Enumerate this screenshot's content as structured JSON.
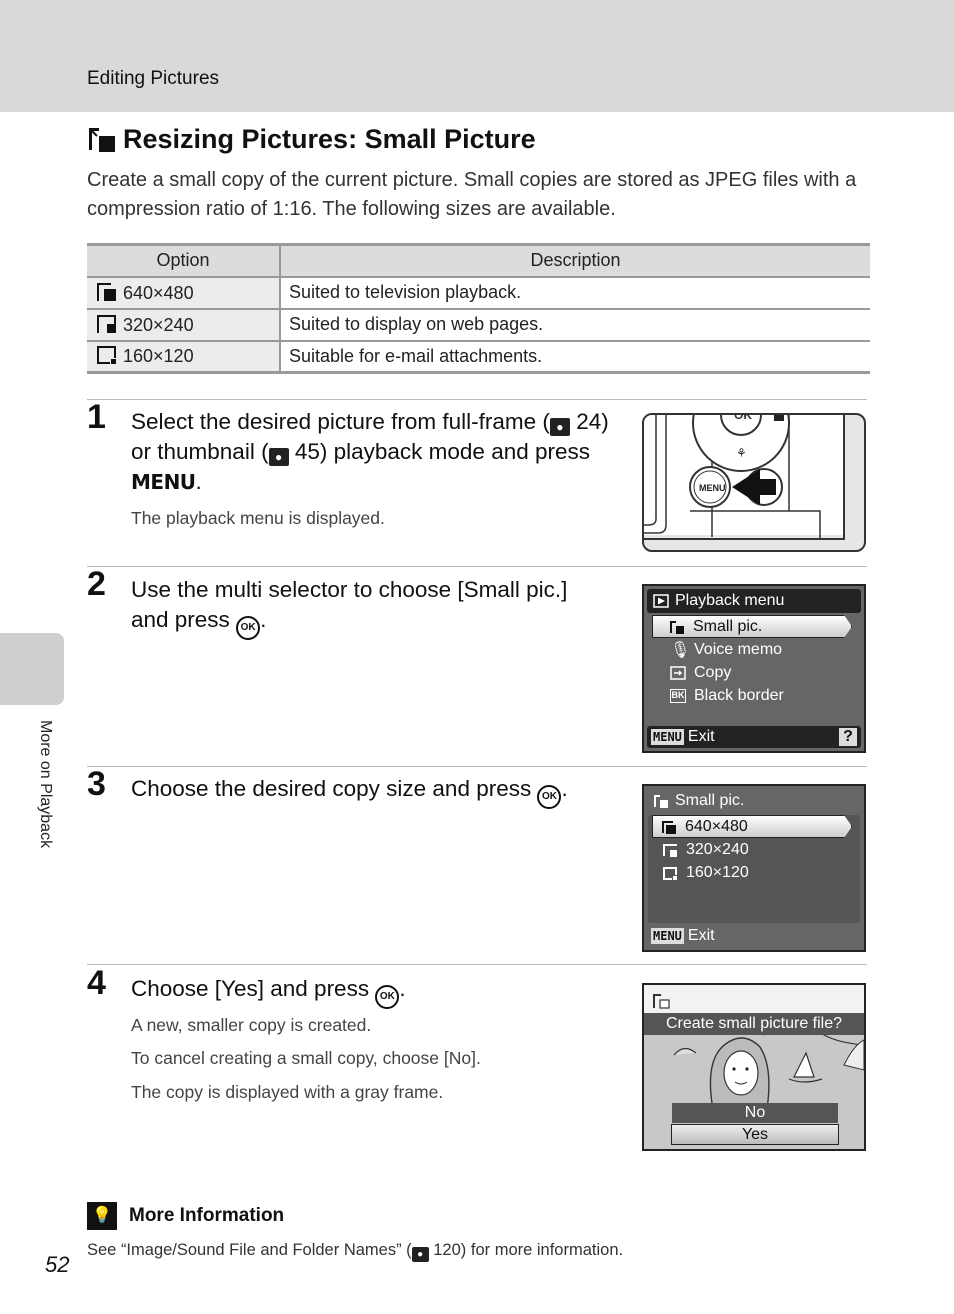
{
  "header": {
    "section_label": "Editing Pictures"
  },
  "side_tab": {
    "label": "More on Playback"
  },
  "title": "Resizing Pictures: Small Picture",
  "intro": "Create a small copy of the current picture. Small copies are stored as JPEG files with a compression ratio of 1:16. The following sizes are available.",
  "table": {
    "headers": [
      "Option",
      "Description"
    ],
    "rows": [
      {
        "option": "640×480",
        "description": "Suited to television playback."
      },
      {
        "option": "320×240",
        "description": "Suited to display on web pages."
      },
      {
        "option": "160×120",
        "description": "Suitable for e-mail attachments."
      }
    ]
  },
  "steps": [
    {
      "num": "1",
      "text_a": "Select the desired picture from full-frame (",
      "ref1": "24",
      "text_b": ") or thumbnail (",
      "ref2": "45",
      "text_c": ") playback mode and press ",
      "menu_word": "MENU",
      "text_end": ".",
      "sub": [
        "The playback menu is displayed."
      ],
      "illustration": {
        "button_label": "MENU"
      }
    },
    {
      "num": "2",
      "text": "Use the multi selector to choose [Small pic.] and press ",
      "ok": "OK",
      "text_end": ".",
      "screen": {
        "title": "Playback menu",
        "items": [
          "Small pic.",
          "Voice memo",
          "Copy",
          "Black border"
        ],
        "selected_index": 0,
        "footer_chip": "MENU",
        "footer_label": "Exit",
        "help": "?"
      }
    },
    {
      "num": "3",
      "text": "Choose the desired copy size and press ",
      "ok": "OK",
      "text_end": ".",
      "screen": {
        "title": "Small pic.",
        "items": [
          "640×480",
          "320×240",
          "160×120"
        ],
        "selected_index": 0,
        "footer_chip": "MENU",
        "footer_label": "Exit"
      }
    },
    {
      "num": "4",
      "text": "Choose [Yes] and press ",
      "ok": "OK",
      "text_end": ".",
      "sub": [
        "A new, smaller copy is created.",
        "To cancel creating a small copy, choose [No].",
        "The copy is displayed with a gray frame."
      ],
      "screen": {
        "prompt": "Create small picture file?",
        "options": [
          "No",
          "Yes"
        ],
        "selected_index": 1
      }
    }
  ],
  "more_info": {
    "title": "More Information",
    "text_a": "See “Image/Sound File and Folder Names” (",
    "ref": "120",
    "text_b": ") for more information."
  },
  "page_number": "52"
}
